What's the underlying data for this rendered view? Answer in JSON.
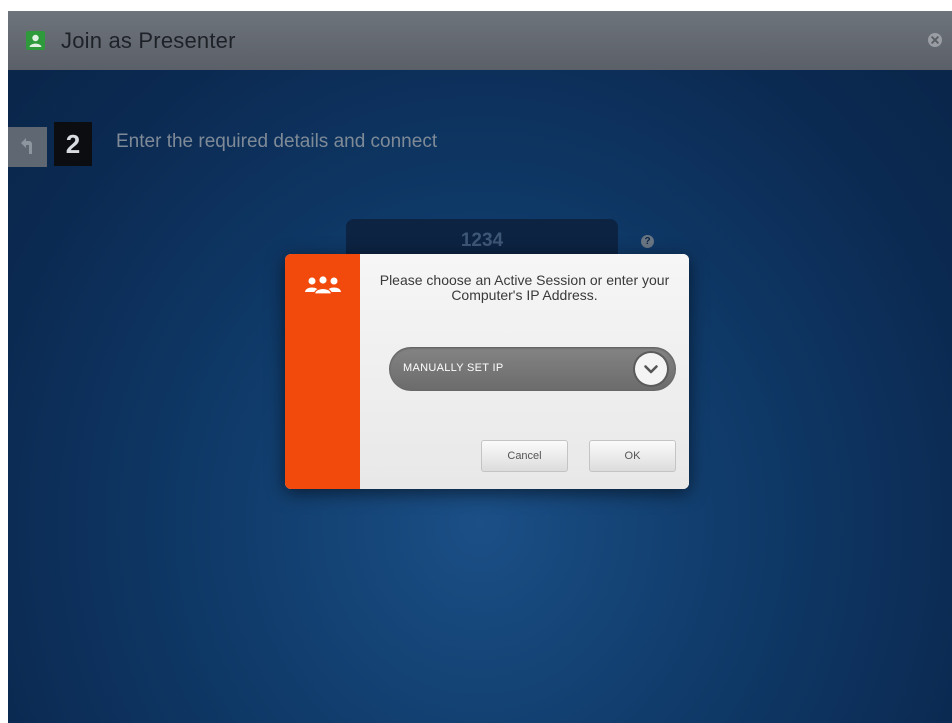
{
  "window": {
    "title": "Join as Presenter",
    "title_icon": "presenter-icon",
    "close_icon": "close-icon"
  },
  "step": {
    "number": "2",
    "text": "Enter the required details and connect",
    "back_icon": "back-arrow-icon"
  },
  "code_field": {
    "value": "1234",
    "help_icon": "?"
  },
  "dialog": {
    "icon": "people-icon",
    "message": "Please choose an Active Session or enter your Computer's IP Address.",
    "select": {
      "selected": "MANUALLY SET IP",
      "arrow_icon": "chevron-down-icon"
    },
    "cancel_label": "Cancel",
    "ok_label": "OK"
  },
  "colors": {
    "accent": "#f24a0c",
    "background": "#0f3a69",
    "title_icon_bg": "#2e9a3c"
  }
}
